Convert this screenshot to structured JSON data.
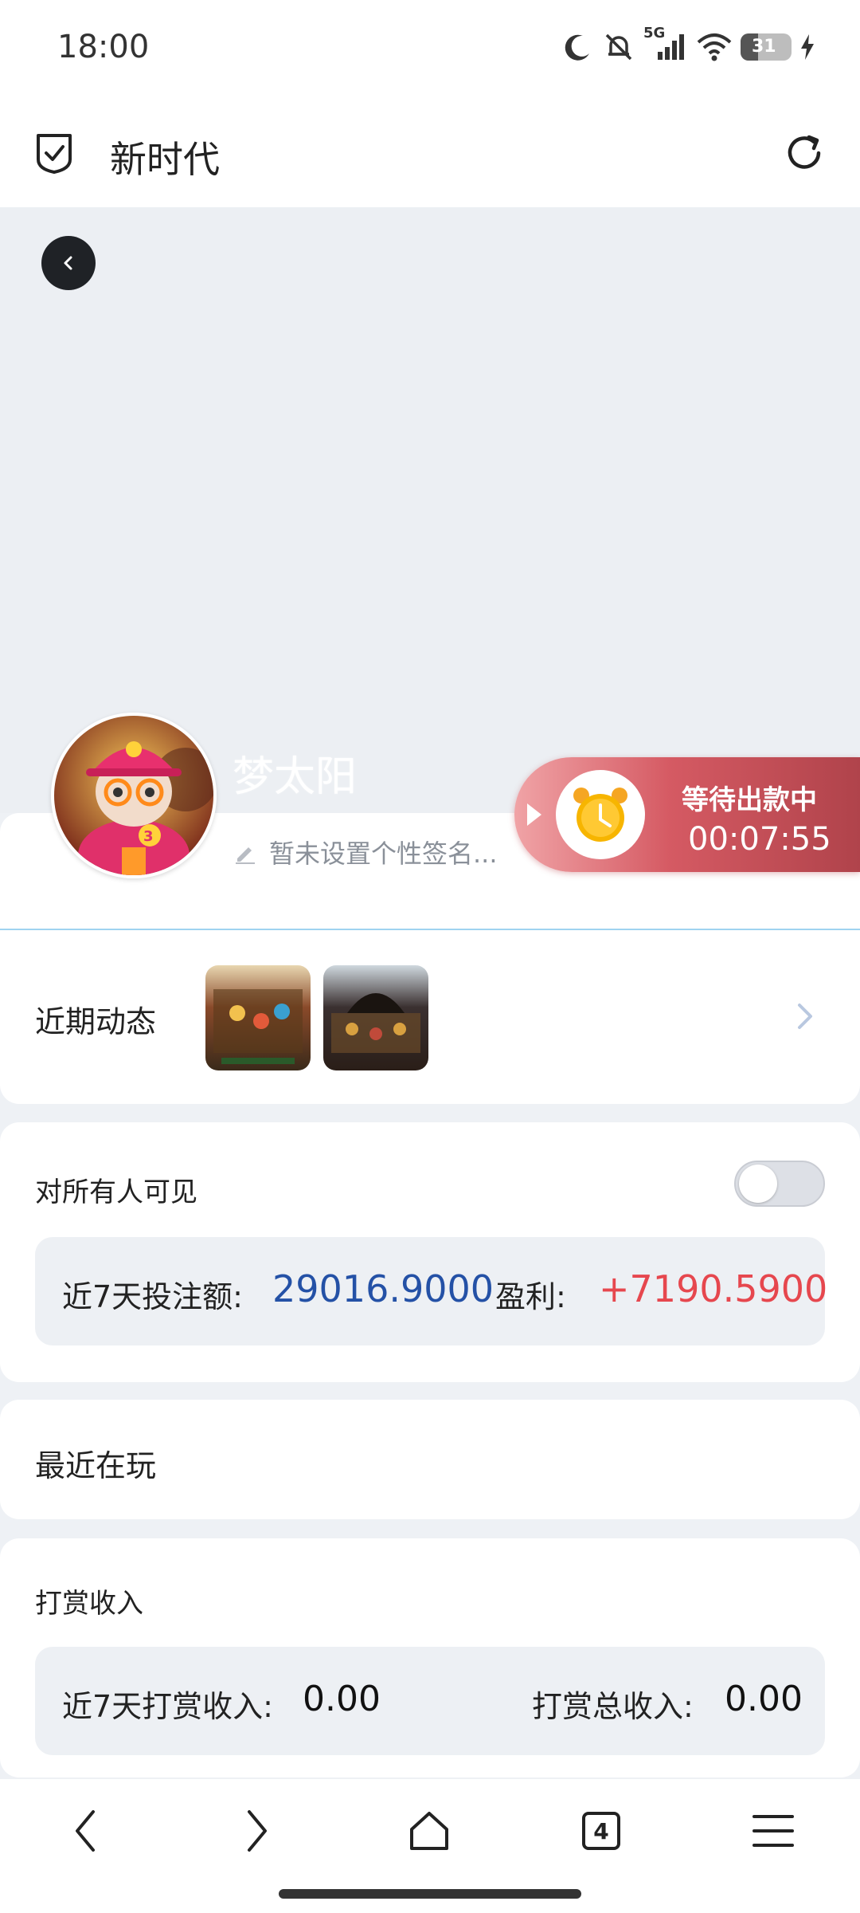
{
  "status_bar": {
    "time": "18:00",
    "network": "5G",
    "battery": "31"
  },
  "browser": {
    "title": "新时代"
  },
  "profile": {
    "username": "梦太阳",
    "signature": "暂未设置个性签名...",
    "avatar_badge": "3"
  },
  "withdraw": {
    "label": "等待出款中",
    "countdown": "00:07:55"
  },
  "recent": {
    "label": "近期动态"
  },
  "visibility": {
    "label": "对所有人可见",
    "enabled": false
  },
  "stats": {
    "bet_label": "近7天投注额:",
    "bet_value": "29016.9000",
    "profit_label": "盈利:",
    "profit_value": "+7190.5900"
  },
  "playing": {
    "label": "最近在玩"
  },
  "tips": {
    "title": "打赏收入",
    "week_label": "近7天打赏收入:",
    "week_value": "0.00",
    "total_label": "打赏总收入:",
    "total_value": "0.00"
  },
  "nav": {
    "tabs_count": "4"
  },
  "colors": {
    "accent_blue": "#2451a6",
    "profit_red": "#e6474e",
    "badge_red": "#c24a54"
  }
}
